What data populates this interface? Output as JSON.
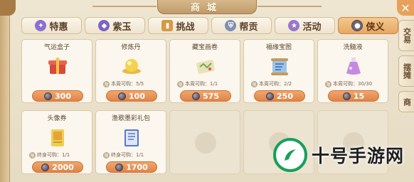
{
  "window": {
    "title": "商城",
    "close_symbol": "✕"
  },
  "tabs": [
    {
      "label": "特惠",
      "icon": "gift-icon",
      "active": false
    },
    {
      "label": "紫玉",
      "icon": "gem-icon",
      "active": false
    },
    {
      "label": "挑战",
      "icon": "flag-icon",
      "active": false
    },
    {
      "label": "帮贡",
      "icon": "shield-icon",
      "active": false
    },
    {
      "label": "活动",
      "icon": "star-icon",
      "active": false
    },
    {
      "label": "侠义",
      "icon": "coin-icon",
      "active": true
    }
  ],
  "side_tabs": [
    {
      "label": "交易"
    },
    {
      "label": "摆摊"
    },
    {
      "label": "商"
    }
  ],
  "items": [
    {
      "name": "气运盒子",
      "price": "300",
      "limit": "",
      "icon": "lucky-box-icon",
      "color": "#d94a3a"
    },
    {
      "name": "修炼丹",
      "price": "100",
      "limit": "本周可购：5/5",
      "icon": "golden-pill-icon",
      "color": "#f0c53a"
    },
    {
      "name": "藏宝画卷",
      "price": "575",
      "limit": "本周可购：1/1",
      "icon": "treasure-map-icon",
      "color": "#a8c47a"
    },
    {
      "name": "福缘宝图",
      "price": "250",
      "limit": "本周可购：2/2",
      "icon": "fortune-scroll-icon",
      "color": "#6fa0d8"
    },
    {
      "name": "洗髓液",
      "price": "15",
      "limit": "本周可购：30/30",
      "icon": "potion-icon",
      "color": "#c58ae0"
    },
    {
      "name": "头像券",
      "price": "2000",
      "limit": "终身可购：1/1",
      "icon": "avatar-ticket-icon",
      "color": "#e8c24a"
    },
    {
      "name": "渔歌墨彩礼包",
      "price": "1700",
      "limit": "终身可购：1/1",
      "icon": "gift-pack-icon",
      "color": "#5a78c8"
    }
  ],
  "watermark": {
    "text": "十号手游网"
  }
}
